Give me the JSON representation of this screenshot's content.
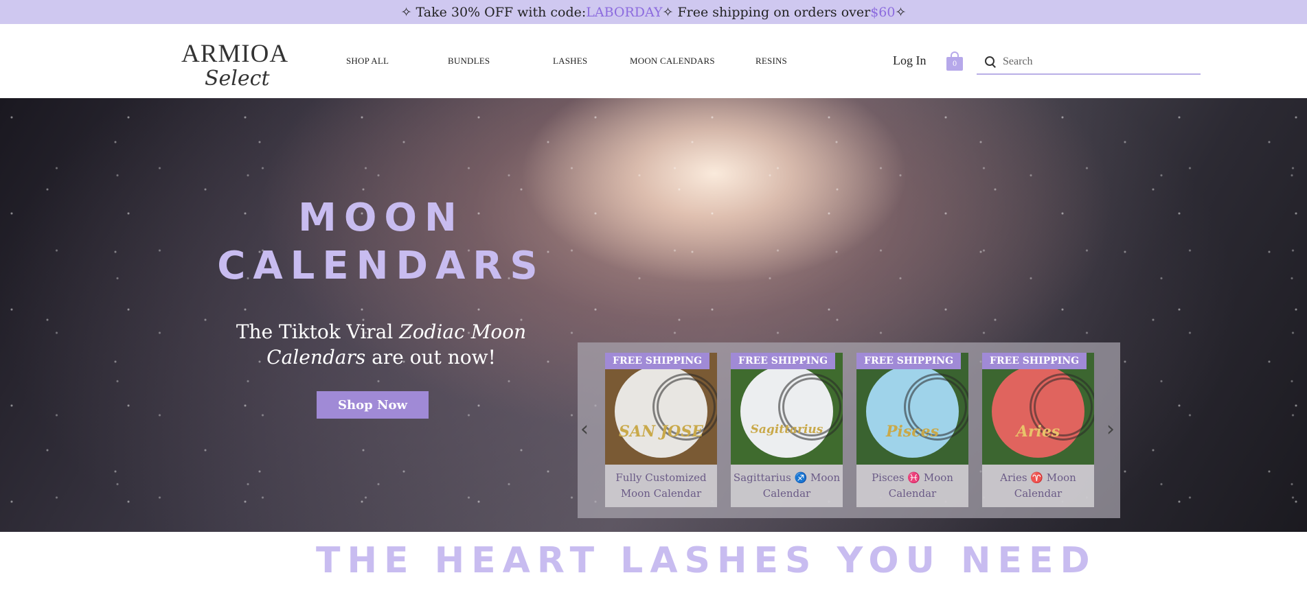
{
  "announcement": {
    "prefix": "✧ Take 30% OFF with code: ",
    "code": "LABORDAY",
    "middle": "✧ Free shipping on orders over ",
    "amount": "$60",
    "suffix": " ✧"
  },
  "logo": {
    "word": "ARMIOA",
    "script": "Select"
  },
  "nav": {
    "items": [
      {
        "label": "SHOP ALL"
      },
      {
        "label": "BUNDLES"
      },
      {
        "label": "LASHES"
      },
      {
        "label": "MOON CALENDARS"
      },
      {
        "label": "RESINS"
      }
    ]
  },
  "header": {
    "login_label": "Log In",
    "cart_count": "0",
    "search_placeholder": "Search"
  },
  "hero": {
    "title_line1": "MOON",
    "title_line2": "CALENDARS",
    "subtitle_plain1": "The Tiktok Viral ",
    "subtitle_italic": "Zodiac Moon Calendars",
    "subtitle_plain2": " are out now!",
    "button_label": "Shop Now"
  },
  "carousel": {
    "prev_icon": "chevron-left-icon",
    "next_icon": "chevron-right-icon",
    "products": [
      {
        "badge": "FREE SHIPPING",
        "disc_text": "SAN JOSE",
        "name": "Fully Customized Moon Calendar",
        "bg": "#7a5a34",
        "disc": "#e8e6e2",
        "word_color": "#c9a94a"
      },
      {
        "badge": "FREE SHIPPING",
        "disc_text": "Sagittarius",
        "name": "Sagittarius ♐ Moon Calendar",
        "bg": "#3f6b2e",
        "disc": "#eceef0",
        "word_color": "#c9a94a"
      },
      {
        "badge": "FREE SHIPPING",
        "disc_text": "Pisces",
        "name": "Pisces ♓ Moon Calendar",
        "bg": "#3a6330",
        "disc": "#9fd3ea",
        "word_color": "#c9a94a"
      },
      {
        "badge": "FREE SHIPPING",
        "disc_text": "Aries",
        "name": "Aries ♈ Moon Calendar",
        "bg": "#3c6630",
        "disc": "#e0645e",
        "word_color": "#e9c36a"
      }
    ]
  },
  "section": {
    "title": "THE HEART LASHES YOU NEED"
  },
  "colors": {
    "accent": "#8c6bde",
    "lavender": "#cfc8f0",
    "button": "#a08ad6"
  }
}
